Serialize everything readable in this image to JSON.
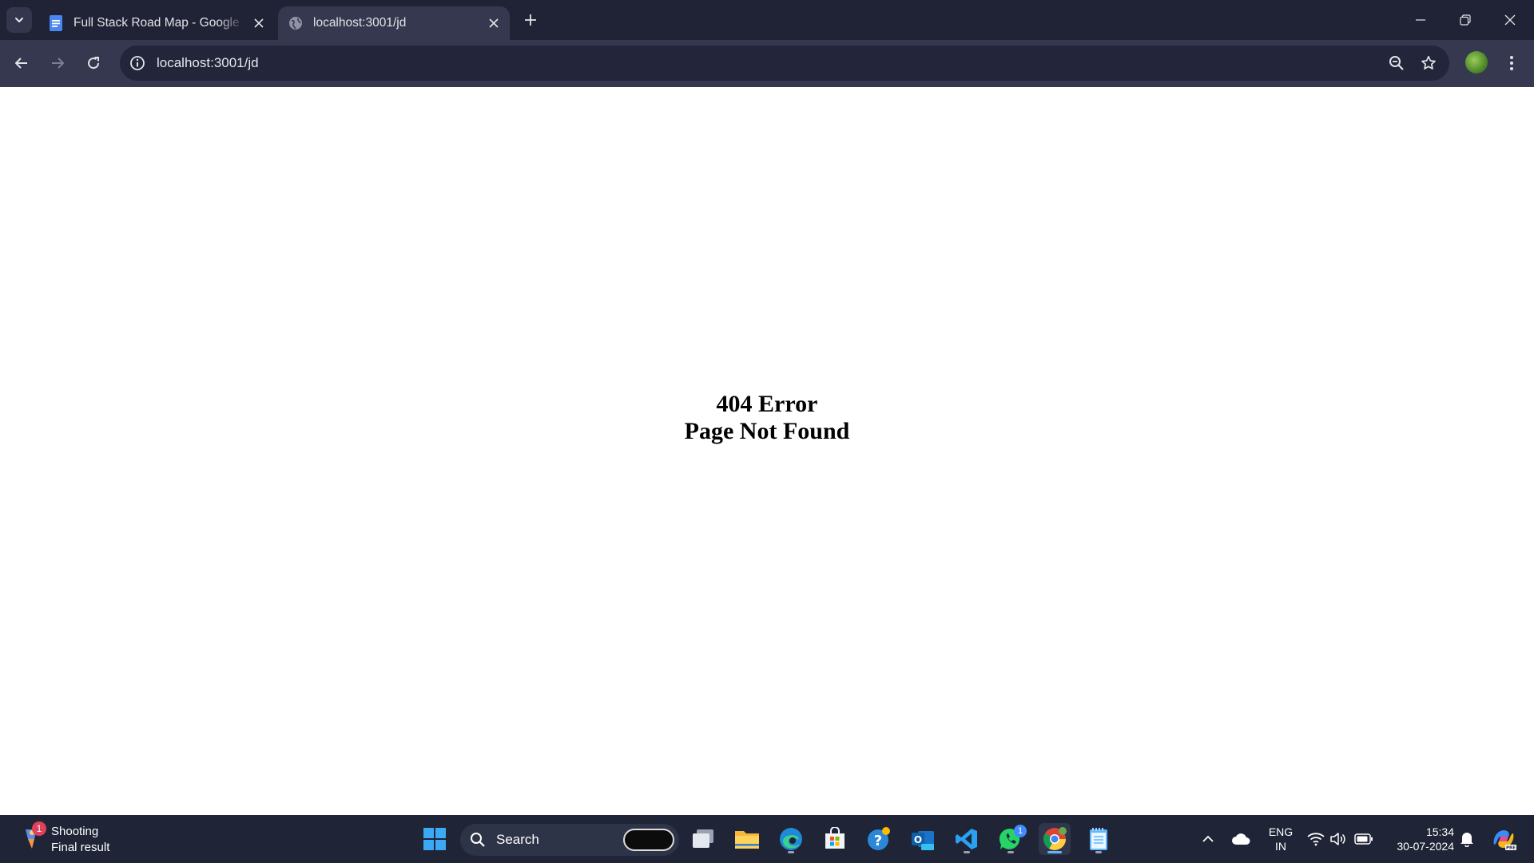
{
  "browser": {
    "tabs": [
      {
        "title": "Full Stack Road Map - Google Docs",
        "favicon": "google-docs-icon",
        "active": false
      },
      {
        "title": "localhost:3001/jd",
        "favicon": "globe-icon",
        "active": true
      }
    ],
    "address": "localhost:3001/jd"
  },
  "page": {
    "line1": "404 Error",
    "line2": "Page Not Found"
  },
  "taskbar": {
    "weather": {
      "badge": "1",
      "title": "Shooting",
      "subtitle": "Final result"
    },
    "search_label": "Search",
    "pinned_apps": [
      "windows-start-icon",
      "task-view-icon",
      "file-explorer-icon",
      "edge-icon",
      "microsoft-store-icon",
      "help-icon",
      "outlook-new-icon",
      "vscode-icon",
      "whatsapp-icon",
      "chrome-icon",
      "notepad-icon"
    ],
    "whatsapp_badge": "1",
    "lang_line1": "ENG",
    "lang_line2": "IN",
    "time": "15:34",
    "date": "30-07-2024"
  },
  "colors": {
    "tabstrip": "#202235",
    "toolbar": "#35384e",
    "omnibox": "#23253a",
    "taskbar": "#1f2436",
    "page_bg": "#ffffff"
  }
}
